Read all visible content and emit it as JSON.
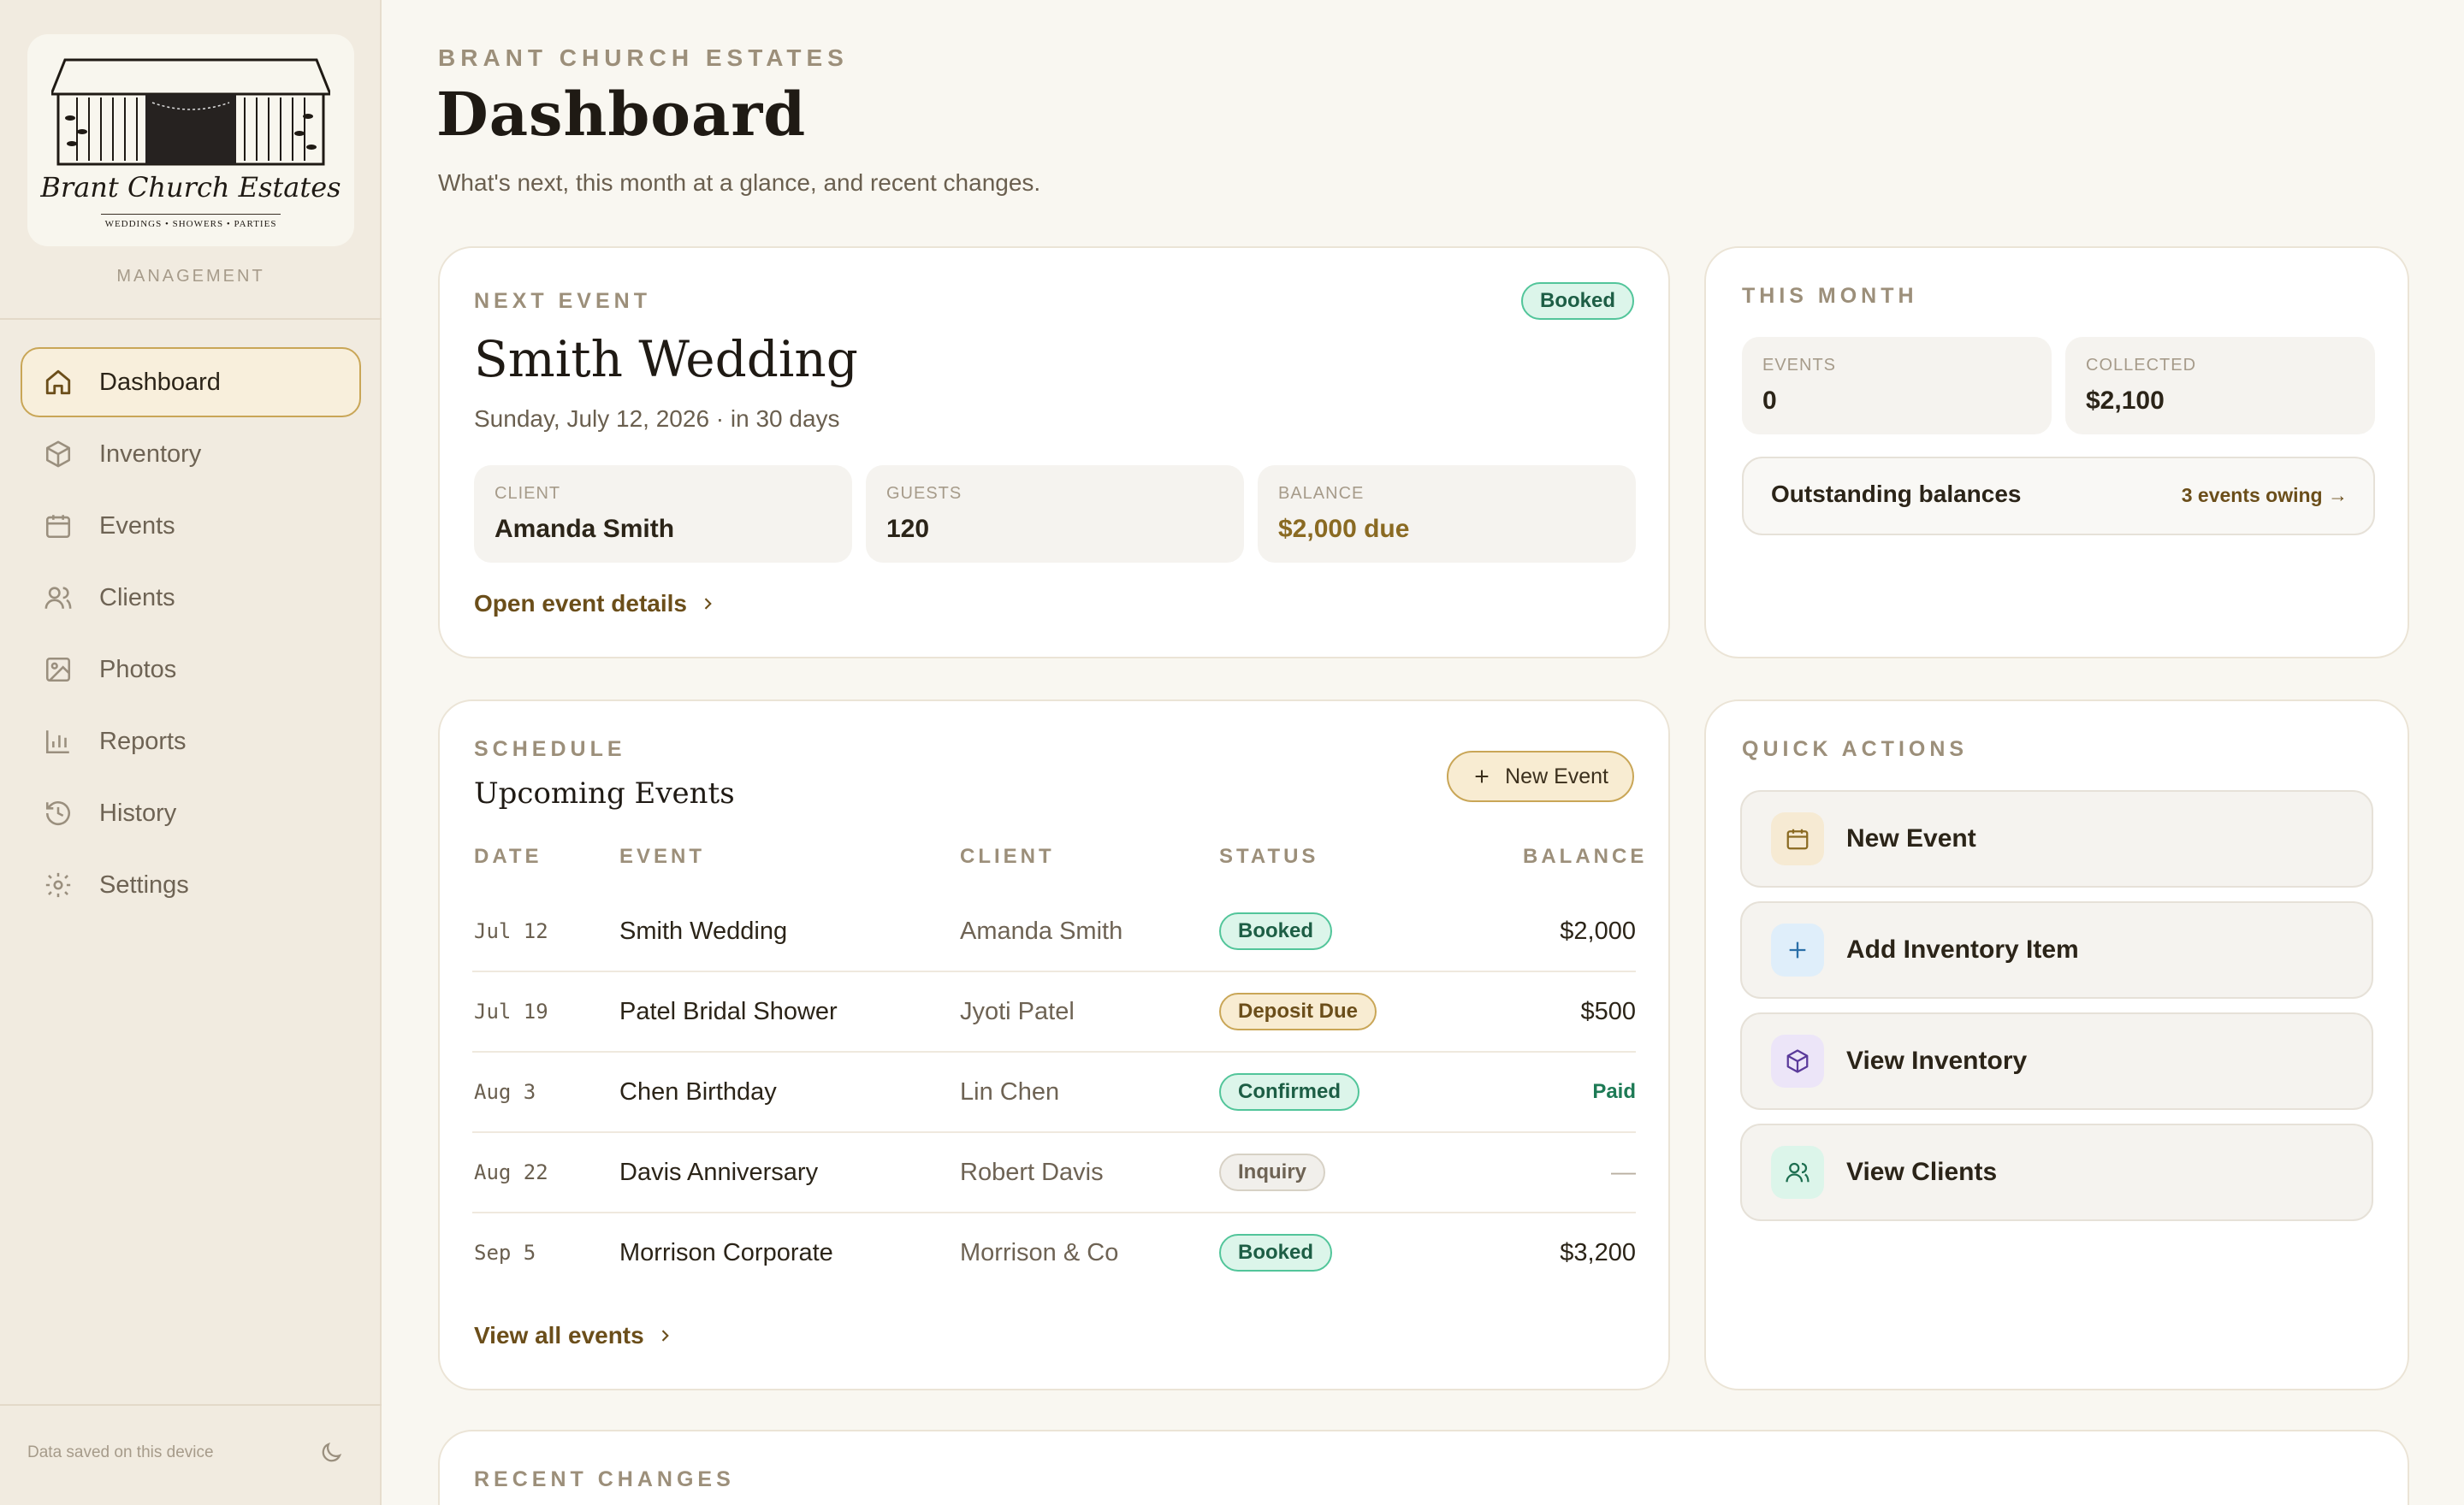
{
  "sidebar": {
    "logo_script": "Brant Church Estates",
    "logo_tagline": "WEDDINGS • SHOWERS • PARTIES",
    "section_label": "MANAGEMENT",
    "items": [
      {
        "label": "Dashboard",
        "icon": "home-icon",
        "active": true
      },
      {
        "label": "Inventory",
        "icon": "box-icon"
      },
      {
        "label": "Events",
        "icon": "calendar-icon"
      },
      {
        "label": "Clients",
        "icon": "users-icon"
      },
      {
        "label": "Photos",
        "icon": "image-icon"
      },
      {
        "label": "Reports",
        "icon": "bar-chart-icon"
      },
      {
        "label": "History",
        "icon": "history-icon"
      },
      {
        "label": "Settings",
        "icon": "gear-icon"
      }
    ],
    "footer_text": "Data saved on this device",
    "theme_icon": "moon-icon"
  },
  "header": {
    "eyebrow": "BRANT CHURCH ESTATES",
    "title": "Dashboard",
    "subtitle": "What's next, this month at a glance, and recent changes."
  },
  "next_event": {
    "eyebrow": "NEXT EVENT",
    "status": "Booked",
    "title": "Smith Wedding",
    "date_line": "Sunday, July 12, 2026 · in 30 days",
    "client_label": "CLIENT",
    "client_value": "Amanda Smith",
    "guests_label": "GUESTS",
    "guests_value": "120",
    "balance_label": "BALANCE",
    "balance_value": "$2,000 due",
    "link": "Open event details"
  },
  "this_month": {
    "eyebrow": "THIS MONTH",
    "events_label": "EVENTS",
    "events_value": "0",
    "collected_label": "COLLECTED",
    "collected_value": "$2,100",
    "outstanding_label": "Outstanding balances",
    "outstanding_link": "3 events owing →"
  },
  "schedule": {
    "eyebrow": "SCHEDULE",
    "title": "Upcoming Events",
    "new_button": "New Event",
    "columns": [
      "DATE",
      "EVENT",
      "CLIENT",
      "STATUS",
      "BALANCE"
    ],
    "rows": [
      {
        "date": "Jul 12",
        "event": "Smith Wedding",
        "client": "Amanda Smith",
        "status": "Booked",
        "balance": "$2,000"
      },
      {
        "date": "Jul 19",
        "event": "Patel Bridal Shower",
        "client": "Jyoti Patel",
        "status": "Deposit Due",
        "balance": "$500"
      },
      {
        "date": "Aug 3",
        "event": "Chen Birthday",
        "client": "Lin Chen",
        "status": "Confirmed",
        "balance": "Paid"
      },
      {
        "date": "Aug 22",
        "event": "Davis Anniversary",
        "client": "Robert Davis",
        "status": "Inquiry",
        "balance": "—"
      },
      {
        "date": "Sep 5",
        "event": "Morrison Corporate",
        "client": "Morrison & Co",
        "status": "Booked",
        "balance": "$3,200"
      }
    ],
    "link": "View all events"
  },
  "quick_actions": {
    "eyebrow": "QUICK ACTIONS",
    "items": [
      {
        "label": "New Event",
        "icon": "calendar-icon"
      },
      {
        "label": "Add Inventory Item",
        "icon": "plus-icon"
      },
      {
        "label": "View Inventory",
        "icon": "box-icon"
      },
      {
        "label": "View Clients",
        "icon": "users-icon"
      }
    ]
  },
  "recent": {
    "eyebrow": "RECENT CHANGES"
  },
  "colors": {
    "accent": "#c9a657",
    "brown_text": "#6b4e1a",
    "booked_green": "#52c59a",
    "paid_green": "#1d7a55",
    "background": "#f9f7f1"
  }
}
